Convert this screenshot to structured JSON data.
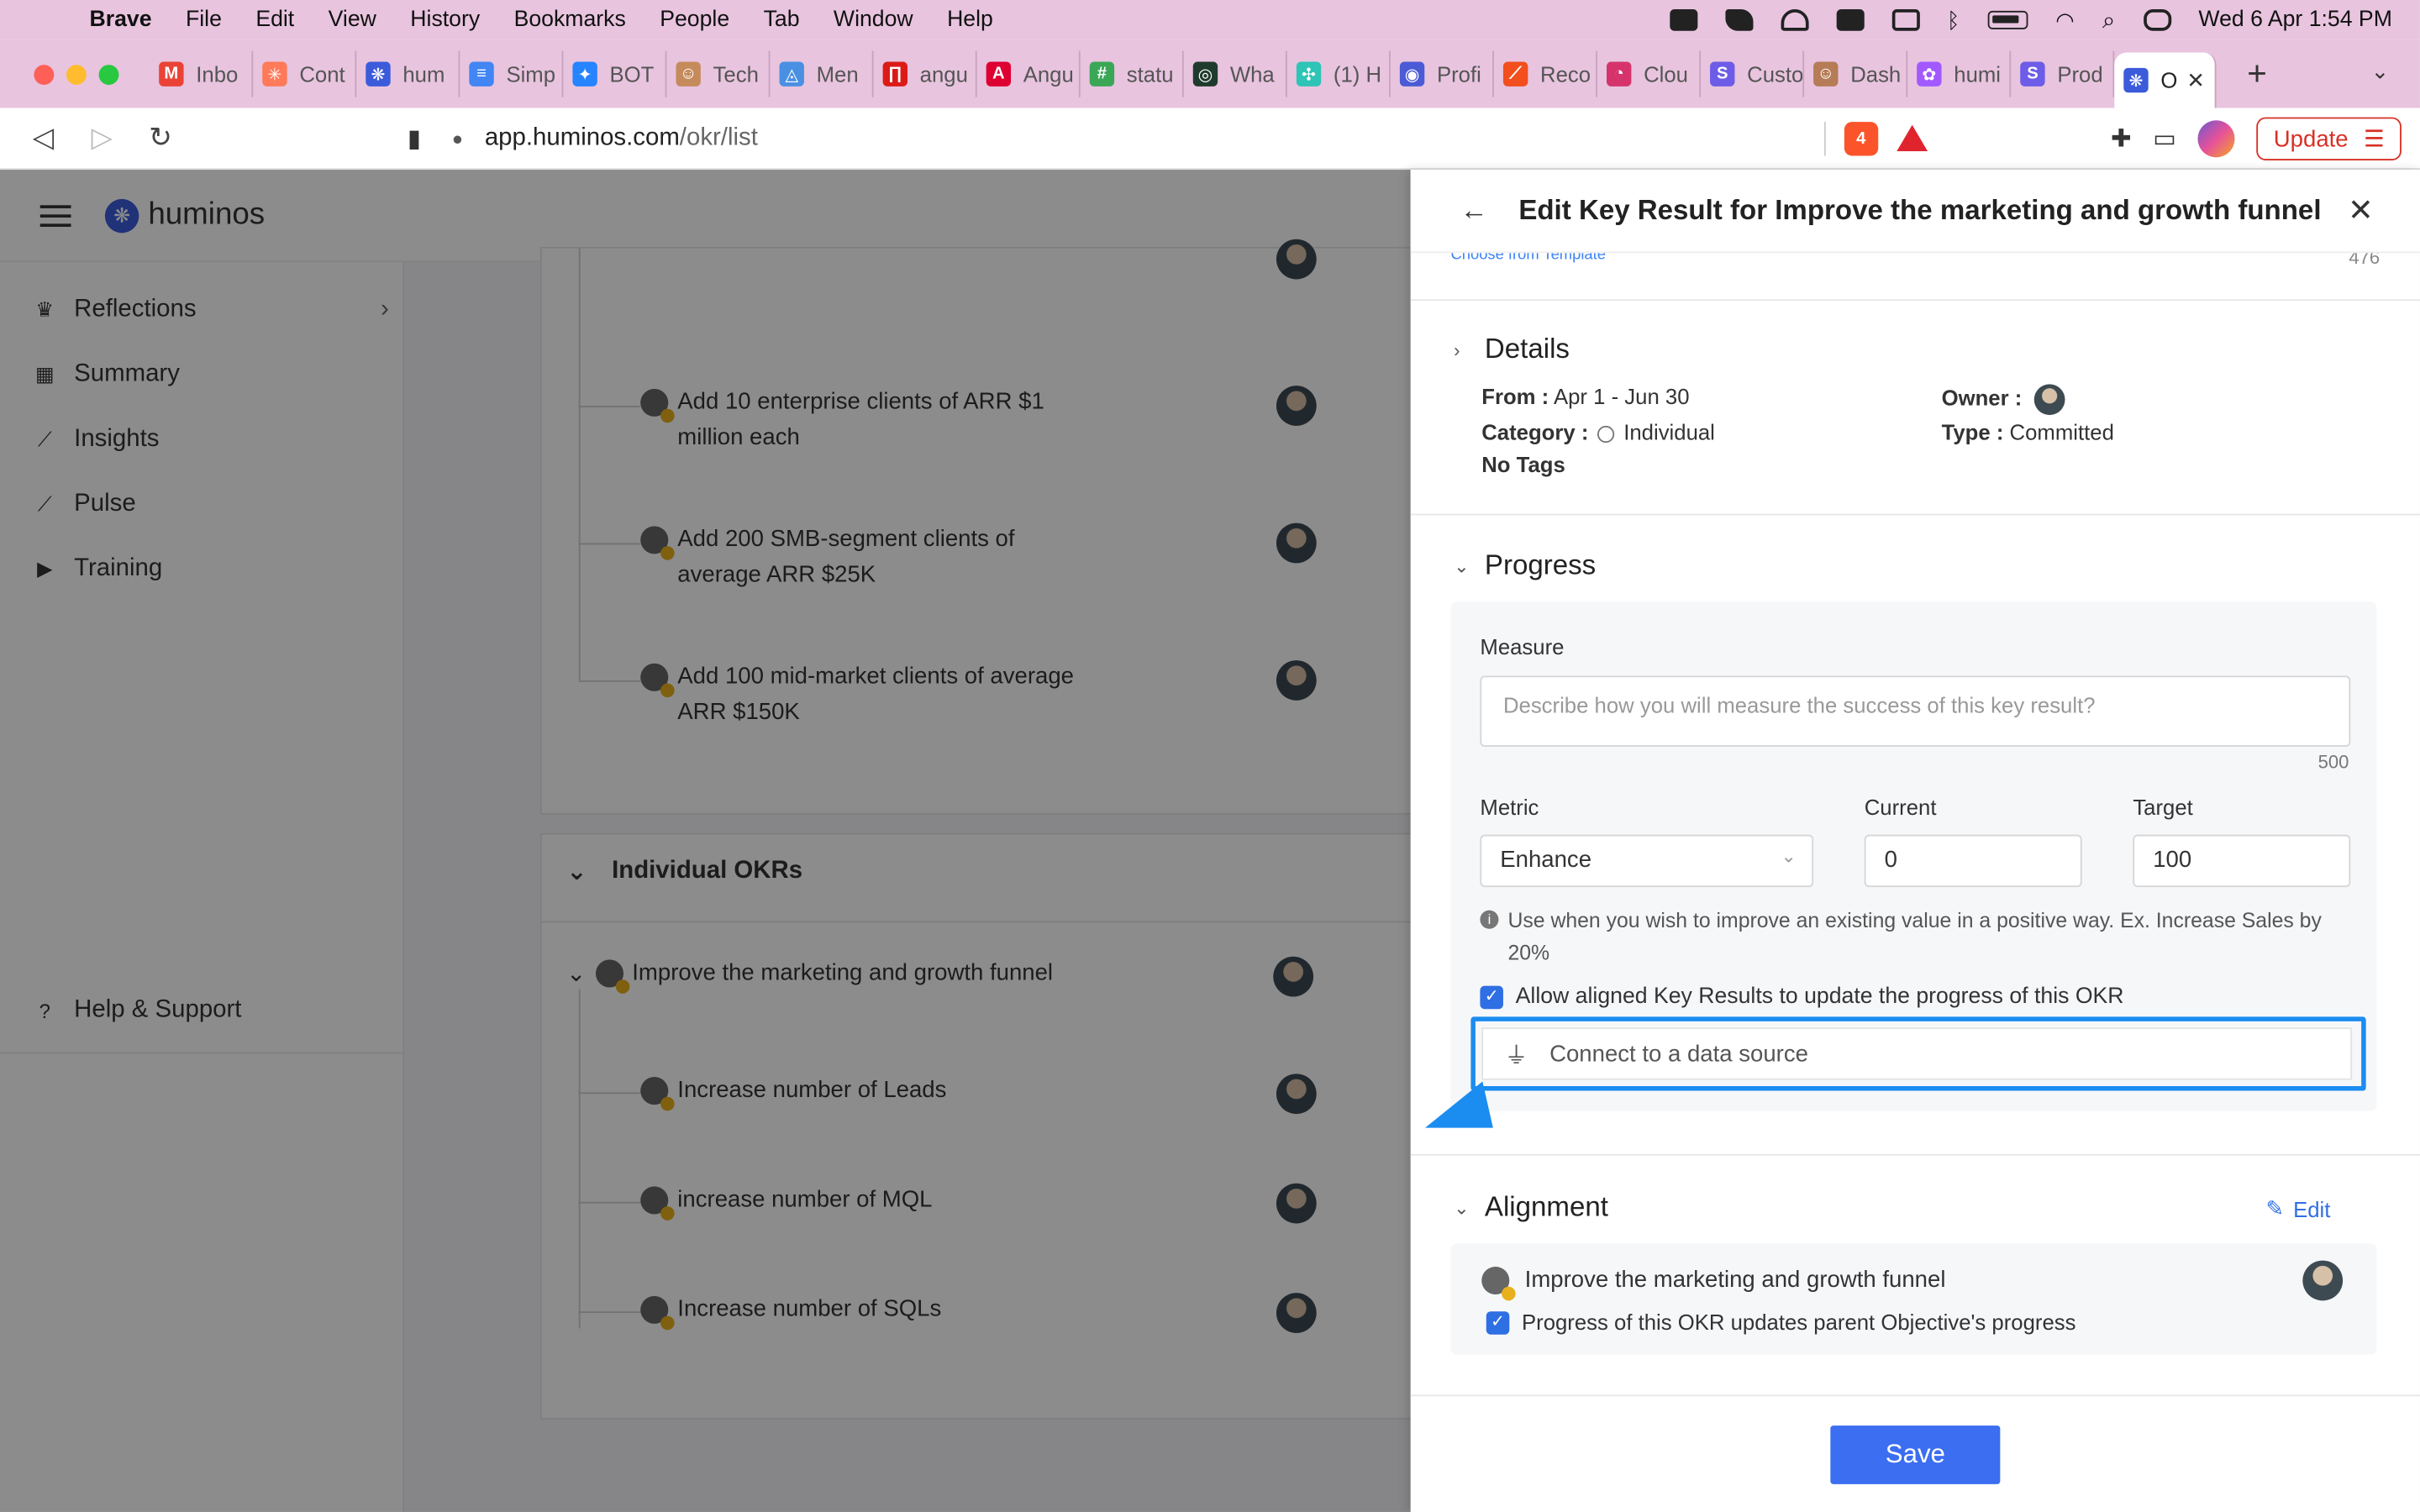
{
  "menubar": {
    "app": "Brave",
    "items": [
      "File",
      "Edit",
      "View",
      "History",
      "Bookmarks",
      "People",
      "Tab",
      "Window",
      "Help"
    ],
    "datetime": "Wed 6 Apr  1:54 PM"
  },
  "tabs": [
    {
      "label": "Inbo",
      "color": "#ea4335",
      "glyph": "M"
    },
    {
      "label": "Cont",
      "color": "#ff7a59",
      "glyph": "✳"
    },
    {
      "label": "hum",
      "color": "#3b5bdb",
      "glyph": "❋"
    },
    {
      "label": "Simp",
      "color": "#4285f4",
      "glyph": "≡"
    },
    {
      "label": "BOT",
      "color": "#2684ff",
      "glyph": "✦"
    },
    {
      "label": "Tech",
      "color": "#c58b5b",
      "glyph": "☺"
    },
    {
      "label": "Men",
      "color": "#4a90e2",
      "glyph": "◬"
    },
    {
      "label": "angu",
      "color": "#dd1b16",
      "glyph": "∏"
    },
    {
      "label": "Angu",
      "color": "#dd0031",
      "glyph": "A"
    },
    {
      "label": "statu",
      "color": "#3aa757",
      "glyph": "#"
    },
    {
      "label": "Wha",
      "color": "#1f3b2d",
      "glyph": "◎"
    },
    {
      "label": "(1) H",
      "color": "#2ec4b6",
      "glyph": "✣"
    },
    {
      "label": "Profi",
      "color": "#4b5bd6",
      "glyph": "◉"
    },
    {
      "label": "Reco",
      "color": "#f24e1e",
      "glyph": "⟋"
    },
    {
      "label": "Clou",
      "color": "#d6336c",
      "glyph": "◔"
    },
    {
      "label": "Custo",
      "color": "#6c5ce7",
      "glyph": "S"
    },
    {
      "label": "Dash",
      "color": "#b57c56",
      "glyph": "☺"
    },
    {
      "label": "humi",
      "color": "#a259ff",
      "glyph": "✿"
    },
    {
      "label": "Prod",
      "color": "#6c5ce7",
      "glyph": "S"
    }
  ],
  "active_tab": {
    "label": "O",
    "color": "#3b5bdb",
    "glyph": "❋"
  },
  "address": {
    "host": "app.huminos.com",
    "path": "/okr/list",
    "brave_badge": "4",
    "update_label": "Update"
  },
  "app": {
    "brand": "huminos",
    "sidebar": [
      {
        "label": "Reflections",
        "icon": "trophy-icon",
        "glyph": "♛"
      },
      {
        "label": "Summary",
        "icon": "grid-icon",
        "glyph": "▦"
      },
      {
        "label": "Insights",
        "icon": "trend-icon",
        "glyph": "⟋"
      },
      {
        "label": "Pulse",
        "icon": "pulse-icon",
        "glyph": "⟋"
      },
      {
        "label": "Training",
        "icon": "play-icon",
        "glyph": "▶"
      }
    ],
    "help": "Help & Support",
    "team_krs": [
      "Add 10 enterprise clients of ARR $1 million each",
      "Add 200 SMB-segment clients of average ARR $25K",
      "Add 100 mid-market clients of average ARR $150K"
    ],
    "individual_section": "Individual OKRs",
    "objective": "Improve the marketing and growth funnel",
    "individual_krs": [
      "Increase number of Leads",
      "increase number of MQL",
      "Increase number of SQLs"
    ]
  },
  "drawer": {
    "title": "Edit Key Result for Improve the marketing and growth funnel",
    "template_link": "Choose from Template",
    "char_count": "476",
    "details": {
      "heading": "Details",
      "from_label": "From :",
      "from_value": "Apr 1 - Jun 30",
      "category_label": "Category :",
      "category_value": "Individual",
      "tags": "No Tags",
      "owner_label": "Owner :",
      "type_label": "Type :",
      "type_value": "Committed"
    },
    "progress": {
      "heading": "Progress",
      "measure_label": "Measure",
      "measure_placeholder": "Describe how you will measure the success of this key result?",
      "measure_count": "500",
      "metric_label": "Metric",
      "metric_value": "Enhance",
      "current_label": "Current",
      "current_value": "0",
      "target_label": "Target",
      "target_value": "100",
      "hint": "Use when you wish to improve an existing value in a positive way. Ex. Increase Sales by 20%",
      "allow_label": "Allow aligned Key Results to update the progress of this OKR",
      "connect_label": "Connect to a data source"
    },
    "alignment": {
      "heading": "Alignment",
      "edit_label": "Edit",
      "parent": "Improve the marketing and growth funnel",
      "updates_label": "Progress of this OKR updates parent Objective's progress"
    },
    "save_label": "Save"
  },
  "colors": {
    "menubar_bg": "#e8c4df",
    "accent": "#3b6ef0",
    "highlight": "#1b8cf0"
  }
}
